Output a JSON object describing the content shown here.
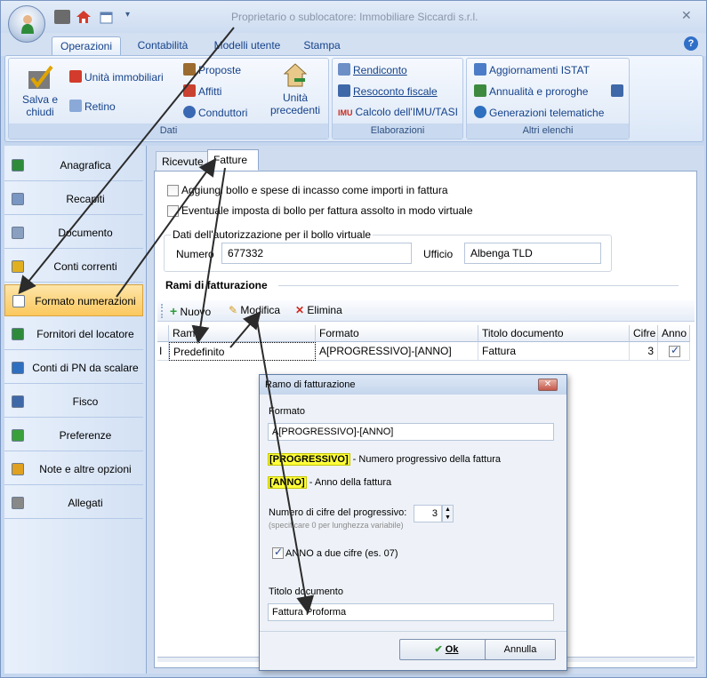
{
  "window": {
    "title": "Proprietario o sublocatore:  Immobiliare Siccardi s.r.l.",
    "close_glyph": "✕"
  },
  "ribbon": {
    "tabs": [
      "Operazioni",
      "Contabilità",
      "Modelli utente",
      "Stampa"
    ],
    "help_glyph": "?",
    "groups": {
      "dati": {
        "label": "Dati",
        "save_close": "Salva e chiudi",
        "unita_immobiliari": "Unità immobiliari",
        "retino": "Retino",
        "proposte": "Proposte",
        "affitti": "Affitti",
        "conduttori": "Conduttori",
        "unita_precedenti": "Unità precedenti"
      },
      "elaborazioni": {
        "label": "Elaborazioni",
        "rendiconto": "Rendiconto",
        "resoconto_fiscale": "Resoconto fiscale",
        "calcolo_imu": "Calcolo dell'IMU/TASI",
        "imu_badge": "IMU"
      },
      "altri_elenchi": {
        "label": "Altri elenchi",
        "aggiornamenti_istat": "Aggiornamenti ISTAT",
        "annualita_proroghe": "Annualità e proroghe",
        "generazioni_telematiche": "Generazioni telematiche"
      }
    }
  },
  "sidebar": {
    "items": [
      {
        "label": "Anagrafica",
        "icon": "person-icon"
      },
      {
        "label": "Recapiti",
        "icon": "document-icon"
      },
      {
        "label": "Documento",
        "icon": "id-card-icon"
      },
      {
        "label": "Conti correnti",
        "icon": "coins-icon"
      },
      {
        "label": "Formato numerazioni",
        "icon": "page-icon",
        "active": true
      },
      {
        "label": "Fornitori del locatore",
        "icon": "person-icon"
      },
      {
        "label": "Conti di PN da scalare",
        "icon": "globe-icon"
      },
      {
        "label": "Fisco",
        "icon": "magnifier-doc-icon"
      },
      {
        "label": "Preferenze",
        "icon": "checkmark-icon"
      },
      {
        "label": "Note e altre opzioni",
        "icon": "note-pencil-icon"
      },
      {
        "label": "Allegati",
        "icon": "paperclip-icon"
      }
    ]
  },
  "content": {
    "tabs": {
      "ricevute": "Ricevute",
      "fatture": "Fatture"
    },
    "bollo_in_fattura": {
      "label": "Aggiungi bollo e spese di incasso come importi in fattura",
      "checked": false
    },
    "bollo_virtuale": {
      "label": "Eventuale imposta di bollo per fattura assolto in modo virtuale",
      "checked": false
    },
    "autorizzazione": {
      "legend": "Dati dell'autorizzazione per il bollo virtuale",
      "numero_label": "Numero",
      "numero_value": "677332",
      "ufficio_label": "Ufficio",
      "ufficio_value": "Albenga TLD"
    },
    "rami": {
      "title": "Rami di fatturazione",
      "toolbar": {
        "nuovo": "Nuovo",
        "modifica": "Modifica",
        "elimina": "Elimina"
      },
      "columns": [
        "Ramo",
        "Formato",
        "Titolo documento",
        "Cifre",
        "Anno"
      ],
      "rows": [
        {
          "indicator": "I",
          "ramo": "Predefinito",
          "formato": "A[PROGRESSIVO]-[ANNO]",
          "titolo": "Fattura",
          "cifre": "3",
          "anno": true
        }
      ]
    }
  },
  "dialog": {
    "title": "Ramo di fatturazione",
    "formato_label": "Formato",
    "formato_value": "A[PROGRESSIVO]-[ANNO]",
    "legend_progressivo_tag": "[PROGRESSIVO]",
    "legend_progressivo_desc": " - Numero progressivo della fattura",
    "legend_anno_tag": "[ANNO]",
    "legend_anno_desc": " - Anno della fattura",
    "cifre_label": "Numero di cifre del progressivo:",
    "cifre_hint": "(specificare 0 per lunghezza variabile)",
    "cifre_value": "3",
    "anno_due_cifre_label": "ANNO a due cifre (es. 07)",
    "anno_due_cifre_checked": true,
    "titolo_label": "Titolo documento",
    "titolo_value": "Fattura Proforma",
    "ok_label": "Ok",
    "annulla_label": "Annulla"
  }
}
